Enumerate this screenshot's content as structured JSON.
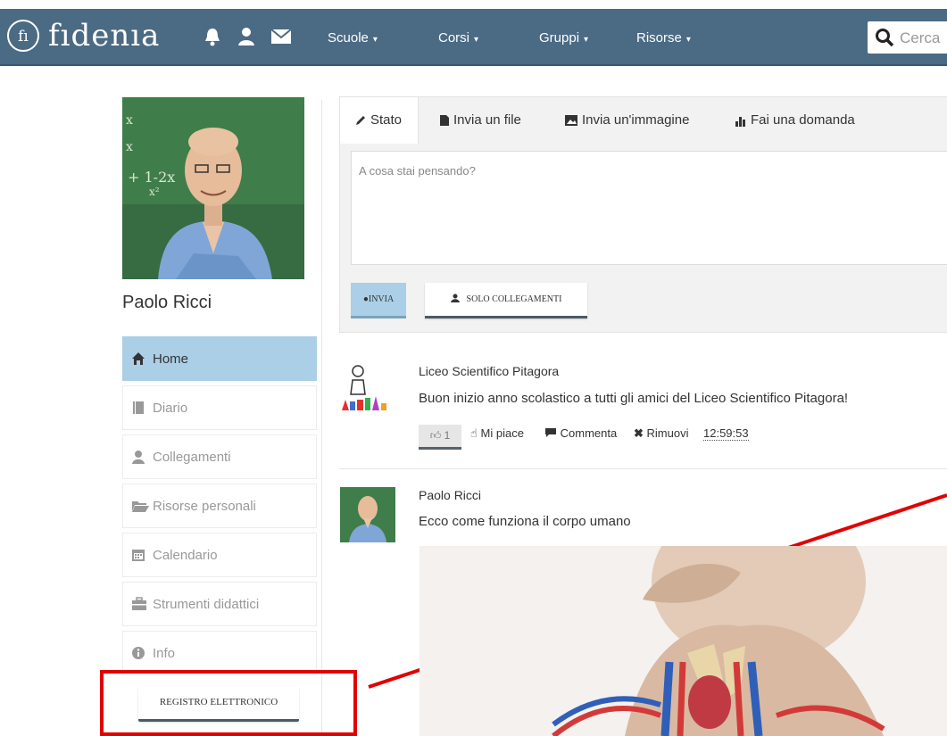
{
  "app": {
    "logo_mark": "fı",
    "logo_text": "fıdenıa",
    "icons": [
      "bell-icon",
      "user-icon",
      "envelope-icon"
    ]
  },
  "nav": {
    "items": [
      {
        "label": "Scuole"
      },
      {
        "label": "Corsi"
      },
      {
        "label": "Gruppi"
      },
      {
        "label": "Risorse"
      }
    ],
    "caret": "▾",
    "search_placeholder": "Cerca"
  },
  "profile": {
    "name": "Paolo Ricci"
  },
  "sidebar": {
    "items": [
      {
        "label": "Home",
        "icon": "home-icon",
        "active": true
      },
      {
        "label": "Diario",
        "icon": "book-icon",
        "active": false
      },
      {
        "label": "Collegamenti",
        "icon": "user-icon",
        "active": false
      },
      {
        "label": "Risorse personali",
        "icon": "folder-open-icon",
        "active": false
      },
      {
        "label": "Calendario",
        "icon": "calendar-icon",
        "active": false
      },
      {
        "label": "Strumenti didattici",
        "icon": "briefcase-icon",
        "active": false
      },
      {
        "label": "Info",
        "icon": "info-icon",
        "active": false
      }
    ],
    "register_button": "REGISTRO ELETTRONICO"
  },
  "composer": {
    "tabs": [
      {
        "label": "Stato",
        "icon": "pencil-icon"
      },
      {
        "label": "Invia un file",
        "icon": "file-icon"
      },
      {
        "label": "Invia un'immagine",
        "icon": "image-icon"
      },
      {
        "label": "Fai una domanda",
        "icon": "bar-chart-icon"
      }
    ],
    "placeholder": "A cosa stai pensando?",
    "send_label": "INVIA",
    "visibility_label": "SOLO COLLEGAMENTI"
  },
  "feed": {
    "posts": [
      {
        "author": "Liceo Scientifico Pitagora",
        "text": "Buon inizio anno scolastico a tutti gli amici del Liceo Scientifico Pitagora!",
        "likes": "1",
        "like_label": "Mi piace",
        "comment_label": "Commenta",
        "remove_label": "Rimuovi",
        "time": "12:59:53"
      },
      {
        "author": "Paolo Ricci",
        "text": "Ecco come funziona il corpo umano"
      }
    ]
  },
  "colors": {
    "topbar": "#4b6a84",
    "active_item": "#aacfe6",
    "highlight": "#e20000"
  }
}
